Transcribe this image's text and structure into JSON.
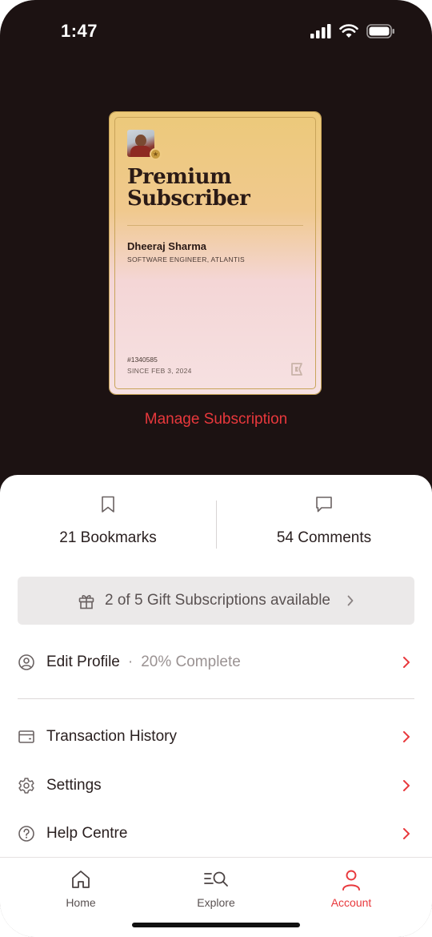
{
  "status_bar": {
    "time": "1:47"
  },
  "card": {
    "title_line1": "Premium",
    "title_line2": "Subscriber",
    "name": "Dheeraj Sharma",
    "role": "SOFTWARE ENGINEER, ATLANTIS",
    "member_id": "#1340585",
    "since": "SINCE FEB 3, 2024"
  },
  "manage_subscription": "Manage Subscription",
  "stats": {
    "bookmarks": "21 Bookmarks",
    "comments": "54 Comments"
  },
  "gift_banner": {
    "text": "2 of 5 Gift Subscriptions available"
  },
  "menu": {
    "edit_profile": {
      "label": "Edit Profile",
      "progress": "20% Complete"
    },
    "transaction_history": "Transaction History",
    "settings": "Settings",
    "help_centre": "Help Centre"
  },
  "tabs": {
    "home": "Home",
    "explore": "Explore",
    "account": "Account",
    "active": "account"
  },
  "colors": {
    "accent": "#e8383c",
    "background_dark": "#1c1212",
    "card_gold": "#ecc97a",
    "card_pink": "#f6e1e2"
  },
  "icons": {
    "bookmarks": "bookmark-icon",
    "comments": "comment-icon",
    "gift": "gift-icon",
    "edit_profile": "user-circle-icon",
    "transaction_history": "wallet-card-icon",
    "settings": "gear-icon",
    "help_centre": "help-circle-icon",
    "home": "home-icon",
    "explore": "explore-search-icon",
    "account": "user-icon"
  }
}
